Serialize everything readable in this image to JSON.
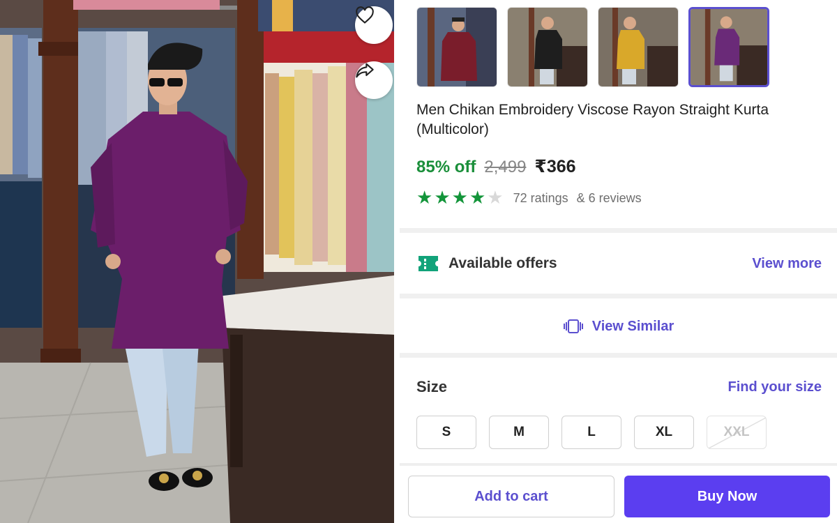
{
  "product": {
    "title": "Men Chikan Embroidery Viscose Rayon Straight Kurta (Multicolor)",
    "discount": "85% off",
    "mrp": "2,499",
    "price": "₹366",
    "rating_stars": 4,
    "ratings_text": "72 ratings",
    "reviews_text": "& 6 reviews"
  },
  "thumbnails": [
    {
      "kurta_color": "#7a1d2b",
      "active": false
    },
    {
      "kurta_color": "#1e1e1e",
      "active": false
    },
    {
      "kurta_color": "#d9a82a",
      "active": false
    },
    {
      "kurta_color": "#6a2a78",
      "active": true
    }
  ],
  "photo": {
    "wishlist_icon": "heart-icon",
    "share_icon": "share-icon",
    "kurta_color": "#6b1e6a"
  },
  "offers": {
    "label": "Available offers",
    "link": "View more",
    "icon": "ticket-icon"
  },
  "similar": {
    "label": "View Similar",
    "icon": "cards-icon"
  },
  "size": {
    "label": "Size",
    "link": "Find your size",
    "options": [
      {
        "label": "S",
        "available": true
      },
      {
        "label": "M",
        "available": true
      },
      {
        "label": "L",
        "available": true
      },
      {
        "label": "XL",
        "available": true
      },
      {
        "label": "XXL",
        "available": false
      }
    ]
  },
  "actions": {
    "add_to_cart": "Add to cart",
    "buy_now": "Buy Now"
  },
  "colors": {
    "accent": "#5b4fcf",
    "buy_button": "#5b3ef0",
    "discount_green": "#1a8f3a",
    "star_green": "#13953a"
  }
}
